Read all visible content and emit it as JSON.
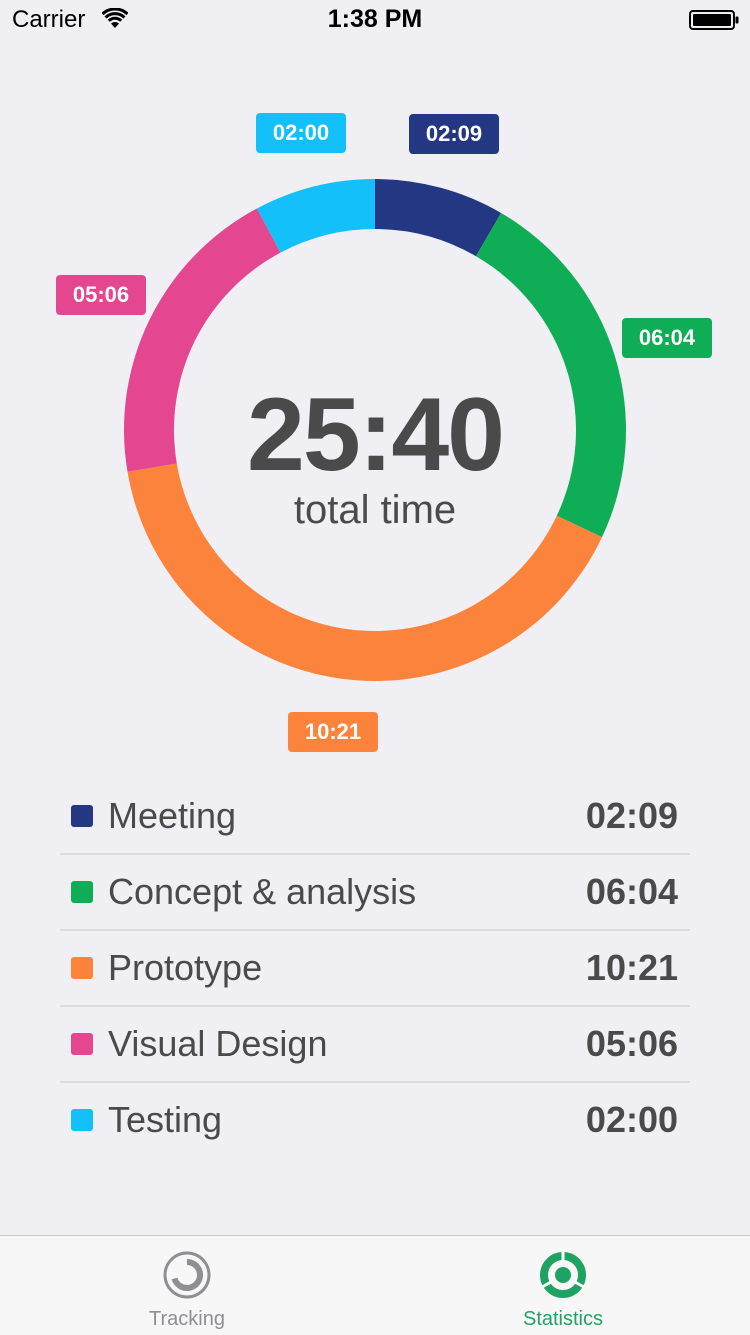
{
  "status_bar": {
    "carrier": "Carrier",
    "time": "1:38 PM"
  },
  "colors": {
    "meeting": "#243782",
    "concept": "#0fae56",
    "prototype": "#fc833b",
    "visual": "#e54690",
    "testing": "#14c0f9",
    "background": "#efeff4",
    "text": "#4a4a4a",
    "tab_active": "#1fa363",
    "tab_inactive": "#8e8e93"
  },
  "summary": {
    "total_value": "25:40",
    "total_label": "total time"
  },
  "chart_data": {
    "type": "donut",
    "unit": "mm:ss",
    "total": "25:40",
    "slices": [
      {
        "name": "Meeting",
        "value": "02:09",
        "minutes": 2.15,
        "color": "#243782"
      },
      {
        "name": "Concept & analysis",
        "value": "06:04",
        "minutes": 6.067,
        "color": "#0fae56"
      },
      {
        "name": "Prototype",
        "value": "10:21",
        "minutes": 10.35,
        "color": "#fc833b"
      },
      {
        "name": "Visual Design",
        "value": "05:06",
        "minutes": 5.1,
        "color": "#e54690"
      },
      {
        "name": "Testing",
        "value": "02:00",
        "minutes": 2.0,
        "color": "#14c0f9"
      }
    ]
  },
  "tabs": [
    {
      "label": "Tracking",
      "icon": "tracking-icon",
      "active": false
    },
    {
      "label": "Statistics",
      "icon": "statistics-icon",
      "active": true
    }
  ]
}
